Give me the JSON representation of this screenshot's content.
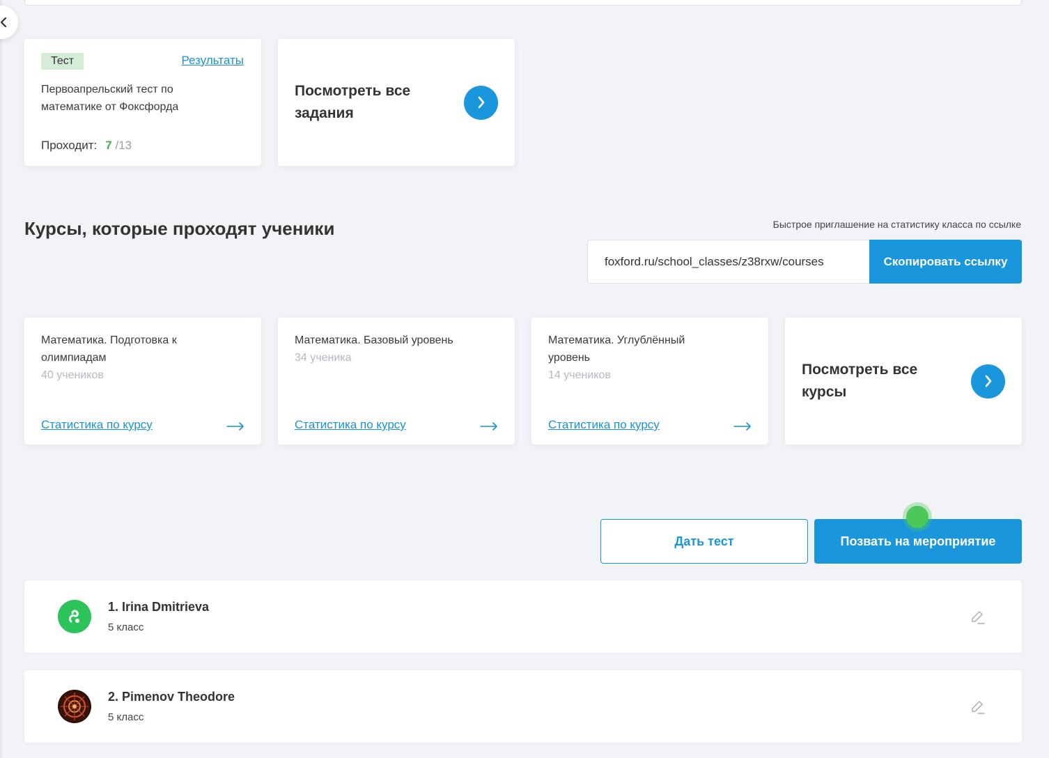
{
  "test_card": {
    "badge": "Тест",
    "results_link": "Результаты",
    "title": "Первоапрельский тест по математике от Фоксфорда",
    "passing_label": "Проходит:",
    "passing_count": "7",
    "passing_total": "/13"
  },
  "see_all_tasks": {
    "label": "Посмотреть все задания"
  },
  "courses_section": {
    "title": "Курсы, которые проходят ученики",
    "invite_label": "Быстрое приглашение на статистику класса по ссылке",
    "invite_link": "foxford.ru/school_classes/z38rxw/courses",
    "copy_button": "Скопировать ссылку"
  },
  "courses": [
    {
      "title": "Математика. Подготовка к олимпиадам",
      "students": "40 учеников",
      "stat_link": "Статистика по курсу"
    },
    {
      "title": "Математика. Базовый уровень",
      "students": "34 ученика",
      "stat_link": "Статистика по курсу"
    },
    {
      "title": "Математика. Углублённый уровень",
      "students": "14 учеников",
      "stat_link": "Статистика по курсу"
    }
  ],
  "see_all_courses": {
    "label": "Посмотреть все курсы"
  },
  "actions": {
    "give_test": "Дать тест",
    "invite_event": "Позвать на мероприятие"
  },
  "students": [
    {
      "name": "1. Irina Dmitrieva",
      "grade": "5 класс"
    },
    {
      "name": "2. Pimenov Theodore",
      "grade": "5 класс"
    }
  ],
  "colors": {
    "accent": "#1a96dc",
    "success": "#4caf50",
    "background": "#f2f3f7"
  }
}
